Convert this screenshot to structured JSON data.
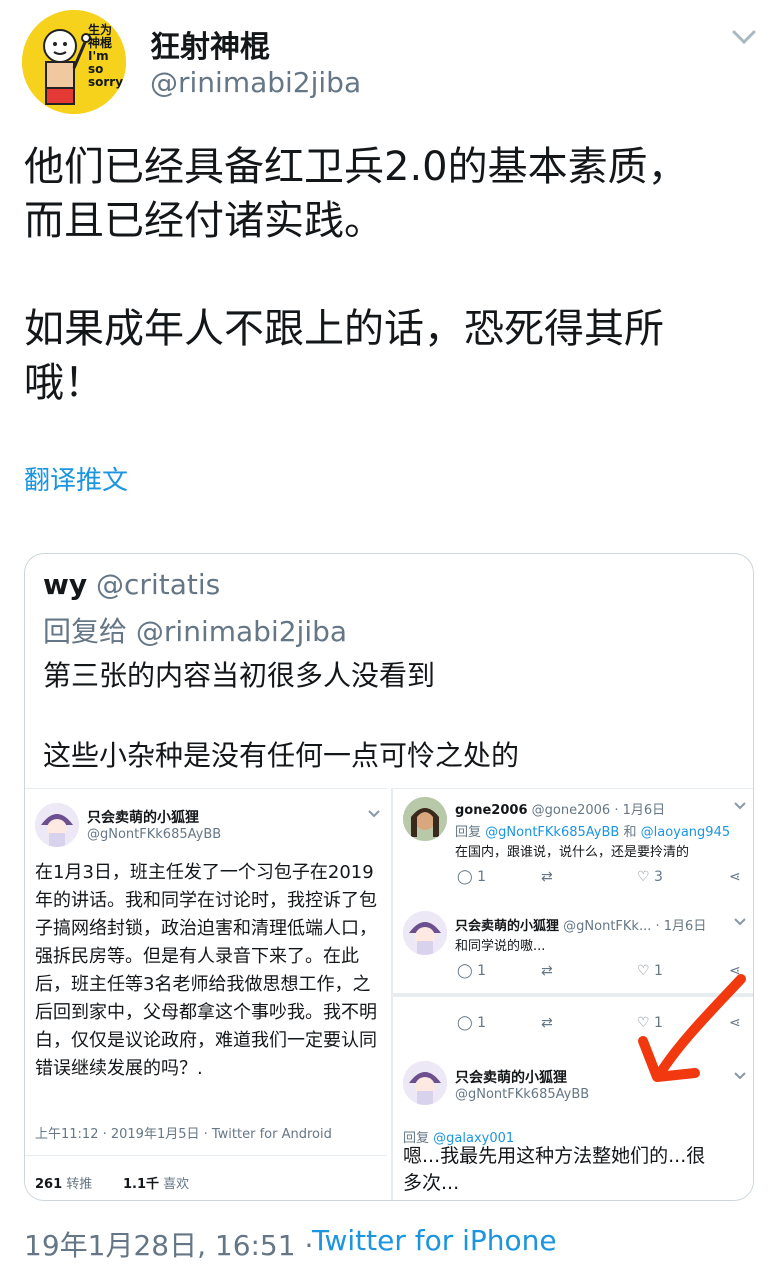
{
  "header": {
    "name": "狂射神棍",
    "handle": "@rinimabi2jiba",
    "avatar_text": [
      "生为",
      "神棍",
      "I'm",
      "so",
      "sorry"
    ]
  },
  "tweet": {
    "line1": "他们已经具备红卫兵2.0的基本素质，",
    "line2": "而且已经付诸实践。",
    "line3": "如果成年人不跟上的话，恐死得其所",
    "line4": "哦！",
    "translate": "翻译推文"
  },
  "quote": {
    "name": "wy",
    "handle": "@critatis",
    "reply_prefix": "回复给",
    "reply_to": "@rinimabi2jiba",
    "text1": "第三张的内容当初很多人没看到",
    "text2": "这些小杂种是没有任何一点可怜之处的"
  },
  "left_image": {
    "name": "只会卖萌的小狐狸",
    "handle": "@gNontFKk685AyBB",
    "body": "在1月3日，班主任发了一个习包子在2019年的讲话。我和同学在讨论时，我控诉了包子搞网络封锁，政治迫害和清理低端人口，强拆民房等。但是有人录音下来了。在此后，班主任等3名老师给我做思想工作，之后回到家中，父母都拿这个事吵我。我不明白，仅仅是议论政府，难道我们一定要认同错误继续发展的吗？.",
    "meta": "上午11:12 · 2019年1月5日 · Twitter for Android",
    "retweets_count": "261",
    "retweets_label": "转推",
    "likes_count": "1.1千",
    "likes_label": "喜欢"
  },
  "right_image": {
    "r1_name": "gone2006",
    "r1_handle": "@gone2006",
    "r1_date": "1月6日",
    "r1_reply_prefix": "回复",
    "r1_reply_user1": "@gNontFKk685AyBB",
    "r1_reply_and": "和",
    "r1_reply_user2": "@laoyang945",
    "r1_text": "在国内，跟谁说，说什么，还是要拎清的",
    "r1_reply_count": "1",
    "r1_like_count": "3",
    "r2_name": "只会卖萌的小狐狸",
    "r2_handle": "@gNontFKk...",
    "r2_date": "1月6日",
    "r2_text": "和同学说的嗷...",
    "r2_reply_count": "1",
    "r2_like_count": "1",
    "r3_reply_count": "1",
    "r3_like_count": "1",
    "r4_name": "只会卖萌的小狐狸",
    "r4_handle": "@gNontFKk685AyBB",
    "r4_reply_prefix": "回复",
    "r4_reply_user": "@galaxy001",
    "r4_text1": "嗯...我最先用这种方法整她们的...很",
    "r4_text2": "多次...",
    "arrow_color": "#f2380f"
  },
  "footer": {
    "datetime": "19年1月28日, 16:51",
    "separator": "·",
    "source": "Twitter for iPhone"
  },
  "colors": {
    "link": "#1b95e0",
    "secondary": "#657786",
    "avatar_bg": "#f6d21c"
  }
}
